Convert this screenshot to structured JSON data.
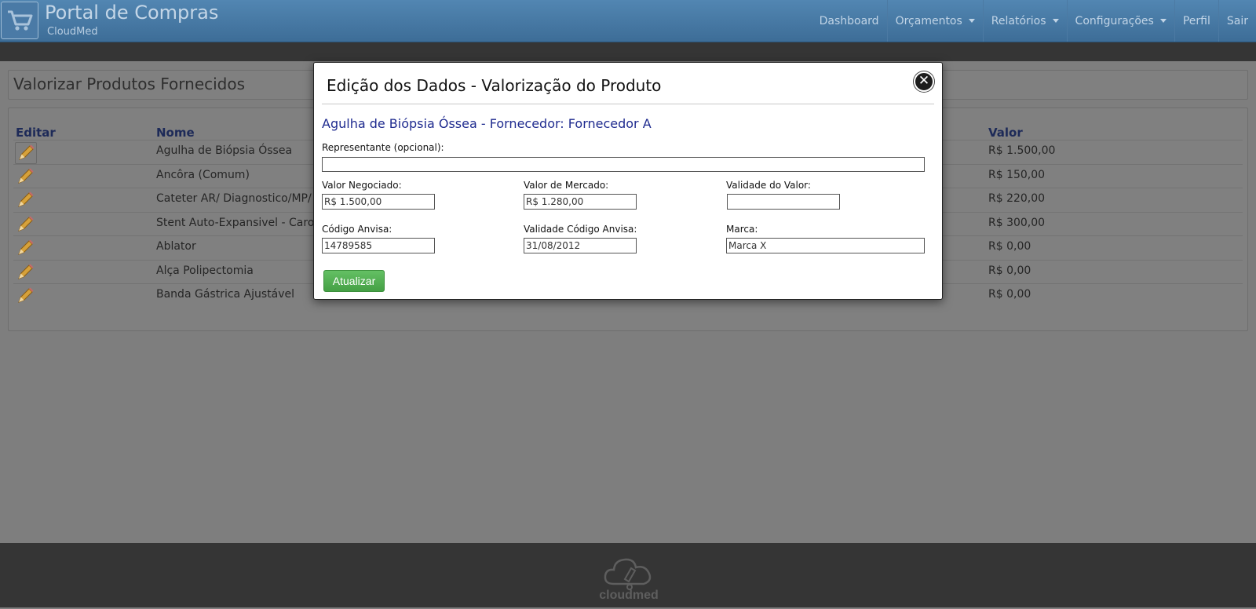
{
  "navbar": {
    "brand_title": "Portal de Compras",
    "brand_subtitle": "CloudMed",
    "items": [
      {
        "label": "Dashboard",
        "dropdown": false
      },
      {
        "label": "Orçamentos",
        "dropdown": true
      },
      {
        "label": "Relatórios",
        "dropdown": true
      },
      {
        "label": "Configurações",
        "dropdown": true
      },
      {
        "label": "Perfil",
        "dropdown": false
      },
      {
        "label": "Sair",
        "dropdown": false
      }
    ]
  },
  "page": {
    "title": "Valorizar Produtos Fornecidos",
    "columns": {
      "edit": "Editar",
      "name": "Nome",
      "value": "Valor"
    },
    "rows": [
      {
        "name": "Agulha de Biópsia Óssea",
        "value": "R$ 1.500,00"
      },
      {
        "name": "Ancôra (Comum)",
        "value": "R$ 150,00"
      },
      {
        "name": "Cateter AR/ Diagnostico/MP/",
        "value": "R$ 220,00"
      },
      {
        "name": "Stent Auto-Expansivel - Caro",
        "value": "R$ 300,00"
      },
      {
        "name": "Ablator",
        "value": "R$ 0,00"
      },
      {
        "name": "Alça Polipectomia",
        "value": "R$ 0,00"
      },
      {
        "name": "Banda Gástrica Ajustável",
        "value": "R$ 0,00"
      }
    ]
  },
  "modal": {
    "title": "Edição dos Dados - Valorização do Produto",
    "close_symbol": "✕",
    "subtitle": "Agulha de Biópsia Óssea - Fornecedor: Fornecedor A",
    "representante": {
      "label": "Representante (opcional):",
      "value": ""
    },
    "valor_negociado": {
      "label": "Valor Negociado:",
      "value": "R$ 1.500,00"
    },
    "valor_mercado": {
      "label": "Valor de Mercado:",
      "value": "R$ 1.280,00"
    },
    "validade_valor": {
      "label": "Validade do Valor:",
      "value": ""
    },
    "codigo_anvisa": {
      "label": "Código Anvisa:",
      "value": "14789585"
    },
    "validade_codigo": {
      "label": "Validade Código Anvisa:",
      "value": "31/08/2012"
    },
    "marca": {
      "label": "Marca:",
      "value": "Marca X"
    },
    "update_button": "Atualizar"
  },
  "footer": {
    "logo_text": "cloudmed"
  },
  "icons": {
    "brand": "cart-icon",
    "edit": "pencil-icon",
    "footer": "cloud-logo-icon"
  }
}
